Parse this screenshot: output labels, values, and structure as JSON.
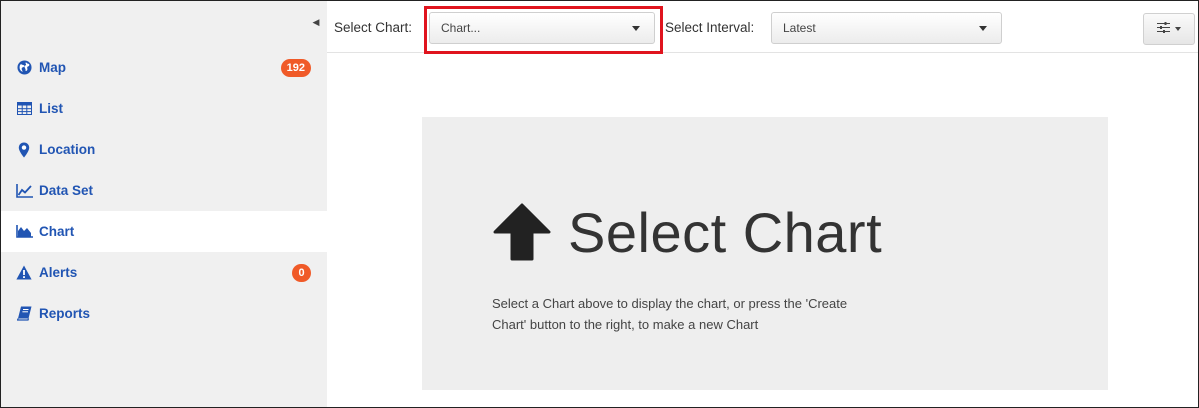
{
  "sidebar": {
    "items": [
      {
        "label": "Map",
        "icon": "globe-icon",
        "badge": "192",
        "active": false
      },
      {
        "label": "List",
        "icon": "table-icon",
        "badge": null,
        "active": false
      },
      {
        "label": "Location",
        "icon": "map-marker-icon",
        "badge": null,
        "active": false
      },
      {
        "label": "Data Set",
        "icon": "line-chart-icon",
        "badge": null,
        "active": false
      },
      {
        "label": "Chart",
        "icon": "area-chart-icon",
        "badge": null,
        "active": true
      },
      {
        "label": "Alerts",
        "icon": "warning-icon",
        "badge": "0",
        "active": false
      },
      {
        "label": "Reports",
        "icon": "book-icon",
        "badge": null,
        "active": false
      }
    ],
    "collapse_icon": "caret-left-icon"
  },
  "toolbar": {
    "chart_label": "Select Chart:",
    "chart_value": "Chart...",
    "interval_label": "Select Interval:",
    "interval_value": "Latest",
    "settings_icon": "sliders-icon"
  },
  "main": {
    "title": "Select Chart",
    "title_icon": "arrow-up-icon",
    "description": "Select a Chart above to display the chart, or press the 'Create Chart' button to the right, to make a new Chart"
  },
  "colors": {
    "accent": "#2155b3",
    "badge": "#f05a28",
    "highlight": "#e0141e",
    "sidebar_bg": "#f0f0f0",
    "panel_bg": "#eeeeee"
  }
}
